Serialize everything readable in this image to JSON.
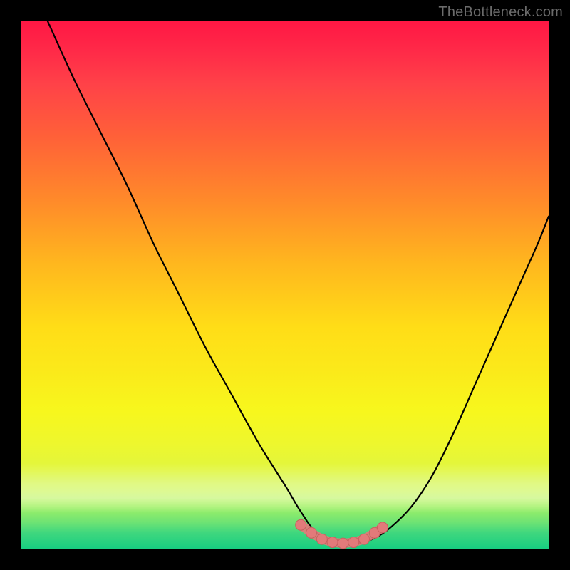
{
  "watermark": "TheBottleneck.com",
  "colors": {
    "background": "#000000",
    "curve_stroke": "#000000",
    "marker_fill": "#e27a7a",
    "marker_stroke": "#c95f5f",
    "gradient_top": "#ff1744",
    "gradient_bottom": "#18ce81"
  },
  "chart_data": {
    "type": "line",
    "title": "",
    "xlabel": "",
    "ylabel": "",
    "xlim": [
      0,
      100
    ],
    "ylim": [
      0,
      100
    ],
    "grid": false,
    "note": "V-shaped bottleneck curve over vertical heat gradient. Minimum (best, green) occurs roughly at x≈55–65. Values are percentage distance from bottom (0 = bottom/green, 100 = top/red), estimated from pixels.",
    "series": [
      {
        "name": "bottleneck-curve",
        "x": [
          5,
          10,
          15,
          20,
          25,
          30,
          35,
          40,
          45,
          50,
          53,
          56,
          60,
          64,
          67,
          70,
          74,
          78,
          82,
          86,
          90,
          94,
          98,
          100
        ],
        "values": [
          100,
          89,
          79,
          69,
          58,
          48,
          38,
          29,
          20,
          12,
          7,
          3,
          1,
          1,
          2,
          4,
          8,
          14,
          22,
          31,
          40,
          49,
          58,
          63
        ]
      }
    ],
    "markers": {
      "name": "highlight-band",
      "x": [
        53,
        55,
        57,
        59,
        61,
        63,
        65,
        67,
        68.5
      ],
      "values": [
        4.5,
        3.0,
        1.8,
        1.2,
        1.0,
        1.2,
        1.8,
        3.0,
        4.0
      ]
    }
  }
}
